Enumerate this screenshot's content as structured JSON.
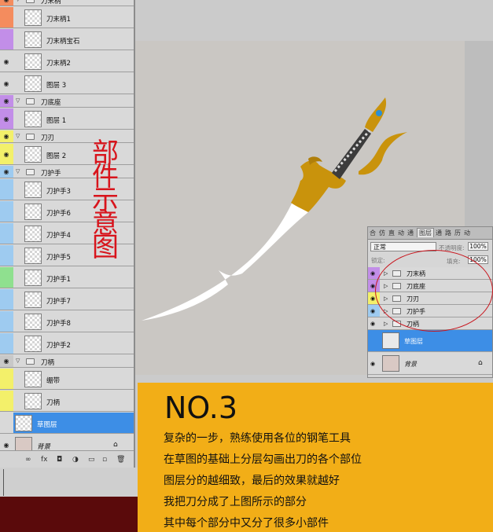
{
  "layers_panel": {
    "rows": [
      {
        "type": "group",
        "label": "刀末柄",
        "color": "#f48c5e",
        "eye": true
      },
      {
        "type": "layer",
        "label": "刀末柄1",
        "color": "#f48c5e",
        "eye": false
      },
      {
        "type": "layer",
        "label": "刀末柄宝石",
        "color": "#c28ee8",
        "eye": false
      },
      {
        "type": "layer",
        "label": "刀末柄2",
        "color": "#d9d9d9",
        "eye": true
      },
      {
        "type": "layer",
        "label": "图层 3",
        "color": "#d9d9d9",
        "eye": true
      },
      {
        "type": "group",
        "label": "刀底座",
        "color": "#c28ee8",
        "eye": true
      },
      {
        "type": "layer",
        "label": "图层 1",
        "color": "#c28ee8",
        "eye": true
      },
      {
        "type": "group",
        "label": "刀刃",
        "color": "#f3f06a",
        "eye": true
      },
      {
        "type": "layer",
        "label": "图层 2",
        "color": "#f3f06a",
        "eye": true
      },
      {
        "type": "group",
        "label": "刀护手",
        "color": "#9ecbf0",
        "eye": true
      },
      {
        "type": "layer",
        "label": "刀护手3",
        "color": "#9ecbf0",
        "eye": false
      },
      {
        "type": "layer",
        "label": "刀护手6",
        "color": "#9ecbf0",
        "eye": false
      },
      {
        "type": "layer",
        "label": "刀护手4",
        "color": "#9ecbf0",
        "eye": false
      },
      {
        "type": "layer",
        "label": "刀护手5",
        "color": "#9ecbf0",
        "eye": false
      },
      {
        "type": "layer",
        "label": "刀护手1",
        "color": "#8fe08f",
        "eye": false
      },
      {
        "type": "layer",
        "label": "刀护手7",
        "color": "#9ecbf0",
        "eye": false
      },
      {
        "type": "layer",
        "label": "刀护手8",
        "color": "#9ecbf0",
        "eye": false
      },
      {
        "type": "layer",
        "label": "刀护手2",
        "color": "#9ecbf0",
        "eye": false
      },
      {
        "type": "group",
        "label": "刀柄",
        "color": "#c8c8c8",
        "eye": true
      },
      {
        "type": "layer",
        "label": "绷带",
        "color": "#f3f06a",
        "eye": false
      },
      {
        "type": "layer",
        "label": "刀柄",
        "color": "#f3f06a",
        "eye": false
      },
      {
        "type": "layer",
        "label": "草图层",
        "color": "#d9d9d9",
        "eye": false,
        "selected": true
      },
      {
        "type": "layer",
        "label": "背景",
        "color": "#d9d9d9",
        "eye": true,
        "locked": true
      }
    ],
    "footer_icons": [
      "∞",
      "fx",
      "◘",
      "◑",
      "▭",
      "▫",
      "🗑"
    ]
  },
  "annotation": [
    "部",
    "件",
    "示",
    "意",
    "图"
  ],
  "small_panel": {
    "tabs": [
      "合",
      "仿",
      "直",
      "动",
      "通",
      "图层",
      "通",
      "路",
      "历",
      "动"
    ],
    "active_tab": "图层",
    "blend_mode": "正常",
    "opacity_label": "不透明度:",
    "opacity": "100%",
    "lock_label": "锁定:",
    "fill_label": "填充:",
    "fill": "100%",
    "groups": [
      {
        "label": "刀末柄",
        "color": "#c28ee8"
      },
      {
        "label": "刀底座",
        "color": "#c28ee8"
      },
      {
        "label": "刀刃",
        "color": "#f3f06a"
      },
      {
        "label": "刀护手",
        "color": "#9ecbf0"
      },
      {
        "label": "刀柄",
        "color": "#d9d9d9"
      }
    ],
    "layers": [
      {
        "label": "草图层",
        "selected": true
      },
      {
        "label": "背景",
        "selected": false,
        "locked": true
      }
    ]
  },
  "caption": {
    "title": "NO.3",
    "lines": [
      "复杂的一步，熟练使用各位的钢笔工具",
      "在草图的基础上分层勾画出刀的各个部位",
      "图层分的越细致，最后的效果就越好",
      "我把刀分成了上图所示的部分",
      "其中每个部分中又分了很多小部件"
    ]
  },
  "colors": {
    "blade": "#ffffff",
    "gold": "#c9930c",
    "grip": "#3c3c3c",
    "gem": "#2a8fd6",
    "annotation_red": "#d8141c",
    "caption_bg": "#f2ae17"
  }
}
